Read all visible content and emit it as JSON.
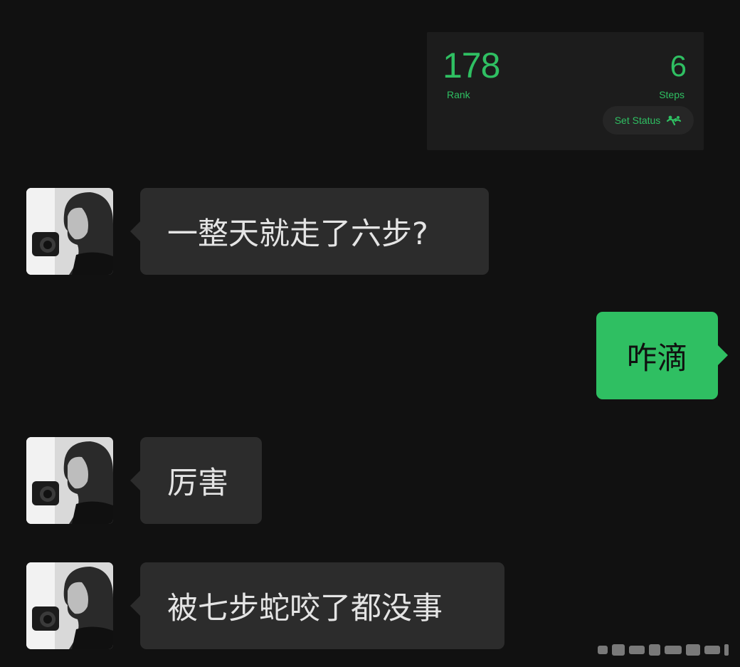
{
  "werun_card": {
    "rank_value": "178",
    "rank_label": "Rank",
    "steps_value": "6",
    "steps_label": "Steps",
    "set_status_label": "Set Status",
    "set_status_icon": "walking-status-icon",
    "accent_color": "#2fbf62"
  },
  "messages": [
    {
      "sender": "contact",
      "avatar": "contact-avatar",
      "text": "一整天就走了六步?"
    },
    {
      "sender": "self",
      "text": "咋滴"
    },
    {
      "sender": "contact",
      "avatar": "contact-avatar",
      "text": "厉害"
    },
    {
      "sender": "contact",
      "avatar": "contact-avatar",
      "text": "被七步蛇咬了都没事"
    }
  ],
  "colors": {
    "background": "#111111",
    "incoming_bubble": "#2c2c2c",
    "outgoing_bubble": "#2fbf62"
  }
}
